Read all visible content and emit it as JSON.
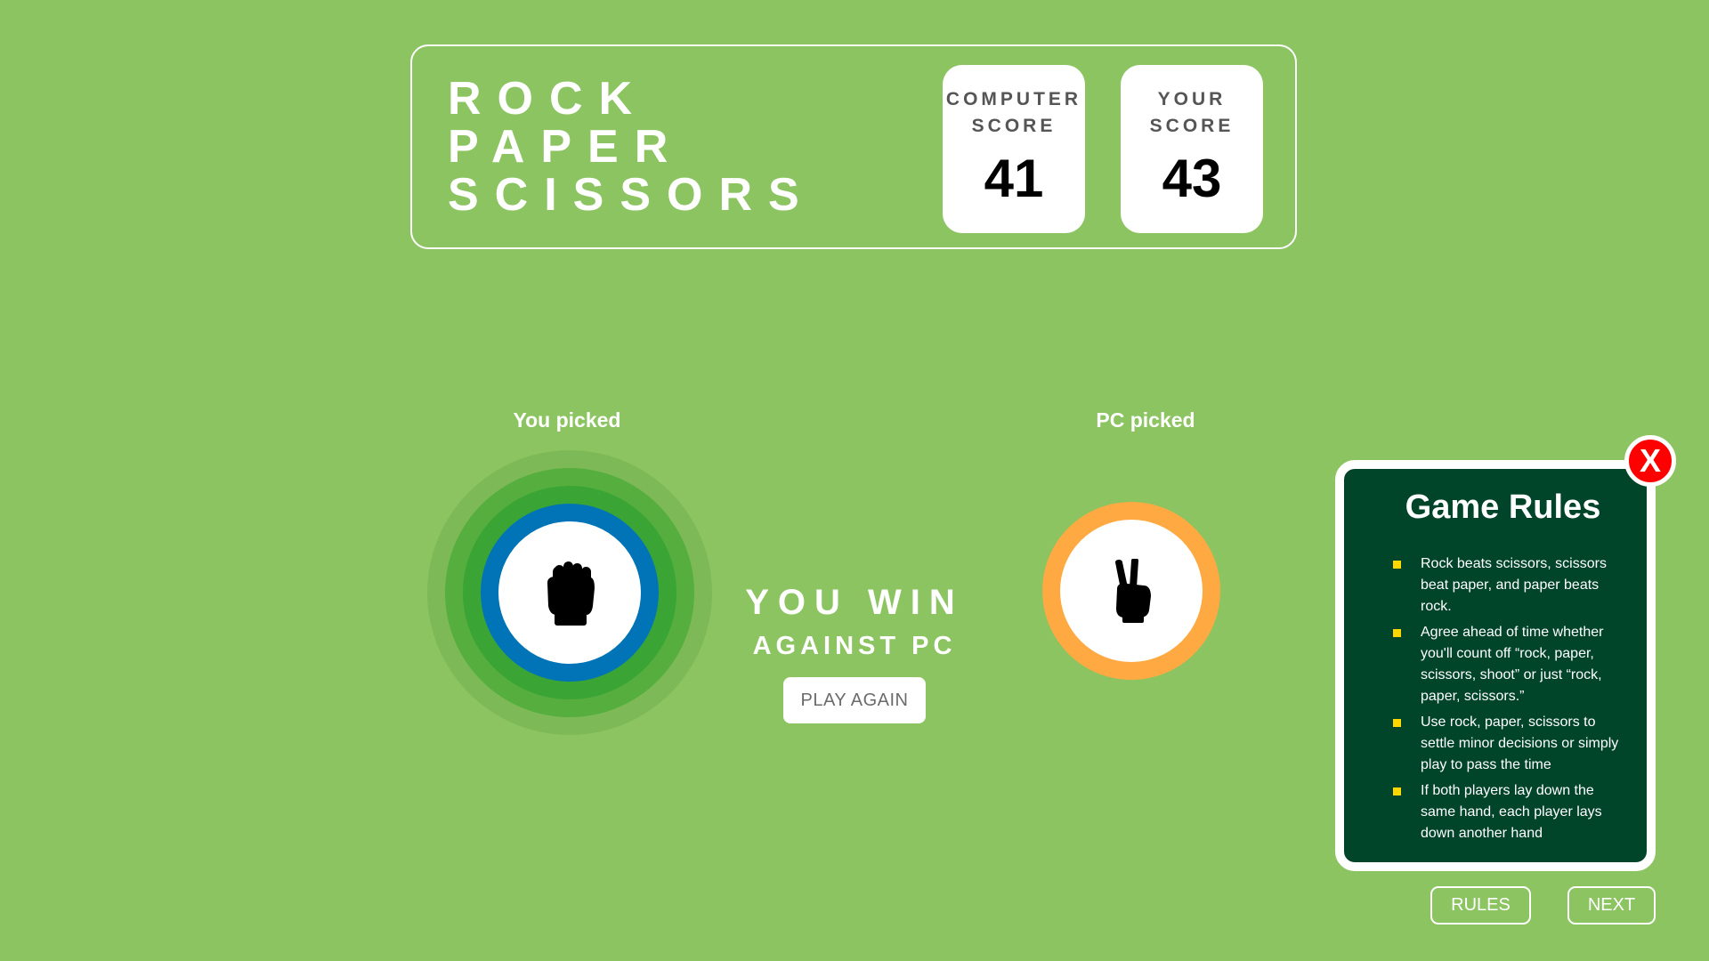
{
  "header": {
    "title_lines": [
      "ROCK",
      "PAPER",
      "SCISSORS"
    ]
  },
  "scores": {
    "computer": {
      "label": "COMPUTER\nSCORE",
      "value": "41"
    },
    "player": {
      "label": "YOUR\nSCORE",
      "value": "43"
    }
  },
  "picks": {
    "you_label": "You picked",
    "pc_label": "PC picked",
    "you_choice_icon": "rock-fist-icon",
    "pc_choice_icon": "scissors-hand-icon",
    "you_ring_color": "#0074b6",
    "pc_ring_color": "#ffa942"
  },
  "result": {
    "main": "YOU WIN",
    "sub": "AGAINST PC",
    "play_again_label": "PLAY AGAIN"
  },
  "rules": {
    "title": "Game Rules",
    "close_label": "X",
    "items": [
      "Rock beats scissors, scissors beat paper, and paper beats rock.",
      "Agree ahead of time whether you'll count off “rock, paper, scissors, shoot” or just “rock, paper, scissors.”",
      "Use rock, paper, scissors to settle minor decisions or simply play to pass the time",
      "If both players lay down the same hand, each player lays down another hand"
    ]
  },
  "buttons": {
    "rules_label": "RULES",
    "next_label": "NEXT"
  },
  "colors": {
    "background": "#8cc461",
    "win_ring": "#3aa534",
    "rules_panel": "#004429",
    "bullet": "#ffd600",
    "close": "#ff0000"
  }
}
